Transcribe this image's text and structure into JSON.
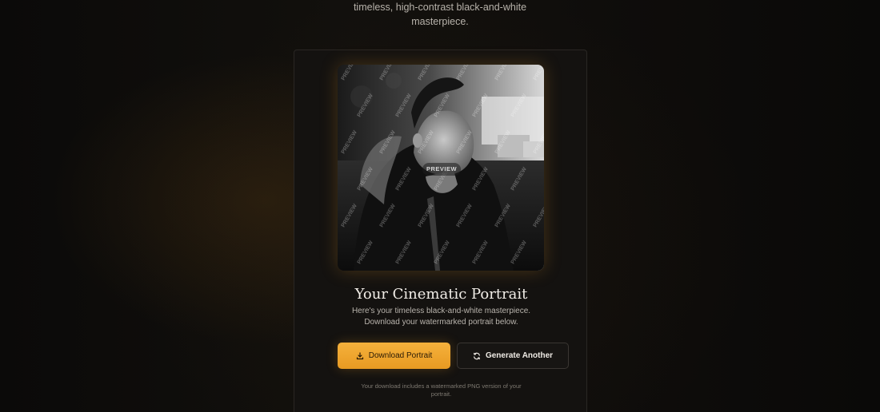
{
  "intro": {
    "line1": "timeless, high-contrast black-and-white",
    "line2": "masterpiece."
  },
  "result_card": {
    "image": {
      "watermark_text": "PREVIEW",
      "center_badge": "PREVIEW"
    },
    "title": "Your Cinematic Portrait",
    "description_line1": "Here's your timeless black-and-white masterpiece.",
    "description_line2": "Download your watermarked portrait below.",
    "download_button": {
      "label": "Download Portrait",
      "icon": "download-icon"
    },
    "generate_button": {
      "label": "Generate Another",
      "icon": "refresh-icon"
    },
    "footnote_line1": "Your download includes a watermarked PNG version of your",
    "footnote_line2": "portrait."
  },
  "colors": {
    "accent": "#f0a52e",
    "background": "#0d0b09",
    "card": "#141210"
  }
}
